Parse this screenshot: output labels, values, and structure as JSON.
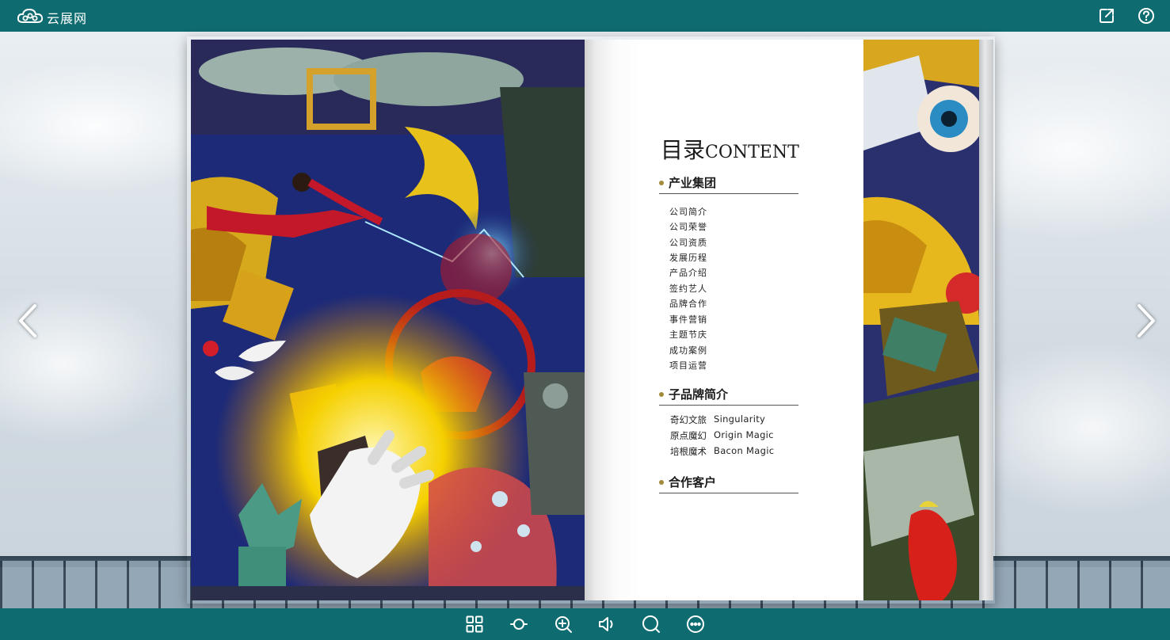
{
  "app": {
    "logo_text": "云展网",
    "colors": {
      "toolbar": "#0e6b70",
      "accent": "#a28a3b",
      "text": "#1b1b1b"
    }
  },
  "header": {
    "icons": [
      "cloud-logo-icon",
      "share-icon",
      "help-icon"
    ]
  },
  "book": {
    "toc": {
      "title_cn": "目录",
      "title_en": "CONTENT",
      "sections": [
        {
          "heading": "产业集团",
          "items": [
            "公司简介",
            "公司荣誉",
            "公司资质",
            "发展历程",
            "产品介绍",
            "签约艺人",
            "品牌合作",
            "事件营销",
            "主题节庆",
            "成功案例",
            "项目运营"
          ]
        },
        {
          "heading": "子品牌简介",
          "brands": [
            {
              "cn": "奇幻文旅",
              "en": "Singularity"
            },
            {
              "cn": "原点魔幻",
              "en": "Origin Magic"
            },
            {
              "cn": "培根魔术",
              "en": "Bacon Magic"
            }
          ]
        },
        {
          "heading": "合作客户"
        }
      ]
    }
  },
  "navigation": {
    "icons": [
      "chevron-left-icon",
      "chevron-right-icon"
    ]
  },
  "toolbar": {
    "icons": [
      "thumbnails-icon",
      "autoplay-icon",
      "zoom-in-icon",
      "sound-icon",
      "search-icon",
      "more-icon"
    ]
  }
}
